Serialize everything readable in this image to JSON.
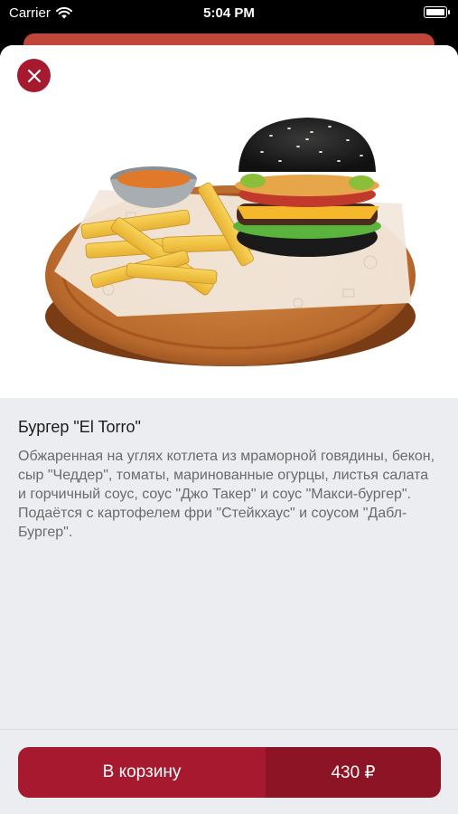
{
  "status_bar": {
    "carrier": "Carrier",
    "time": "5:04 PM"
  },
  "product": {
    "title": "Бургер \"El Torro\"",
    "description": "Обжаренная на углях котлета из мраморной говядины, бекон, сыр \"Чеддер\", томаты, маринованные огурцы, листья салата и горчичный соус, соус \"Джо Такер\" и соус \"Макси-бургер\". Подаётся с картофелем фри \"Стейкхаус\" и соусом \"Дабл-Бургер\"."
  },
  "actions": {
    "add_to_cart_label": "В корзину",
    "price": "430 ₽"
  },
  "colors": {
    "accent": "#a6192e",
    "accent_dark": "#8c1424",
    "background": "#ebedf0"
  },
  "icons": [
    "wifi-icon",
    "battery-icon",
    "close-icon"
  ]
}
